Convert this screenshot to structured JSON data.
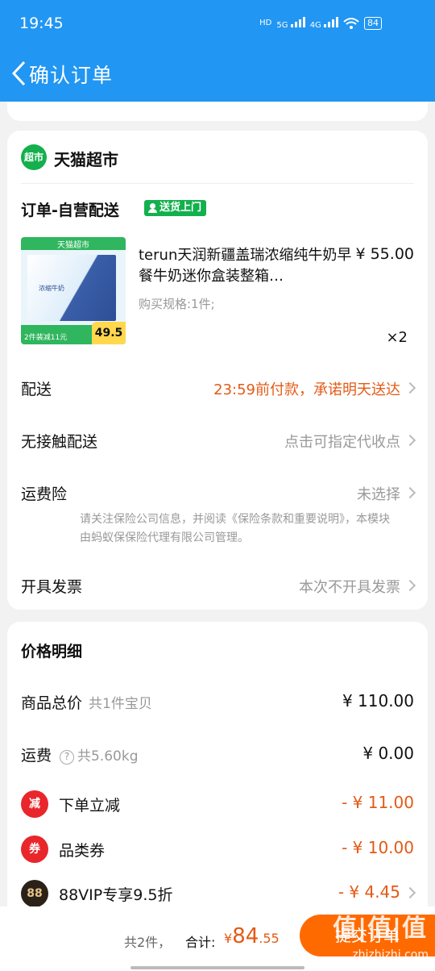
{
  "status_bar": {
    "time": "19:45",
    "net1": "HD",
    "net2": "5G",
    "net3": "4G",
    "battery": "84"
  },
  "header": {
    "title": "确认订单"
  },
  "shop": {
    "logo_text": "超市",
    "name": "天猫超市"
  },
  "order": {
    "type": "订单-自营配送",
    "badge": "送货上门"
  },
  "product": {
    "image_top_tag": "天猫超市",
    "image_box_text": "浓缩牛奶",
    "image_bottom_tag": "2件装减11元",
    "image_price": "49.5",
    "title": "terun天润新疆盖瑞浓缩纯牛奶早餐牛奶迷你盒装整箱…",
    "price": "¥ 55.00",
    "spec": "购买规格:1件;",
    "qty": "×2"
  },
  "options": {
    "delivery": {
      "label": "配送",
      "value": "23:59前付款，承诺明天送达"
    },
    "contactless": {
      "label": "无接触配送",
      "value": "点击可指定代收点"
    },
    "insurance": {
      "label": "运费险",
      "value": "未选择",
      "notice": "请关注保险公司信息，并阅读《保险条款和重要说明》，本模块由蚂蚁保保险代理有限公司管理。"
    },
    "invoice": {
      "label": "开具发票",
      "value": "本次不开具发票"
    }
  },
  "price_detail": {
    "title": "价格明细",
    "goods_total": {
      "label": "商品总价",
      "sub": "共1件宝贝",
      "value": "¥ 110.00"
    },
    "shipping": {
      "label": "运费",
      "sub": "共5.60kg",
      "value": "¥ 0.00"
    },
    "discounts": [
      {
        "icon": "减",
        "label": "下单立减",
        "value": "- ¥ 11.00",
        "color": "#e8262b"
      },
      {
        "icon": "券",
        "label": "品类券",
        "value": "- ¥ 10.00",
        "color": "#e8262b"
      },
      {
        "icon": "88",
        "label": "88VIP专享9.5折",
        "value": "- ¥ 4.45",
        "color": "#2b2118"
      }
    ]
  },
  "bottom_bar": {
    "count": "共2件，",
    "total_label": "合计:",
    "currency": "¥",
    "total_int": "84",
    "total_dec": ".55",
    "submit": "提交订单"
  },
  "watermark": {
    "text": "值|值|值",
    "sub": "zhizhizhi.com"
  }
}
